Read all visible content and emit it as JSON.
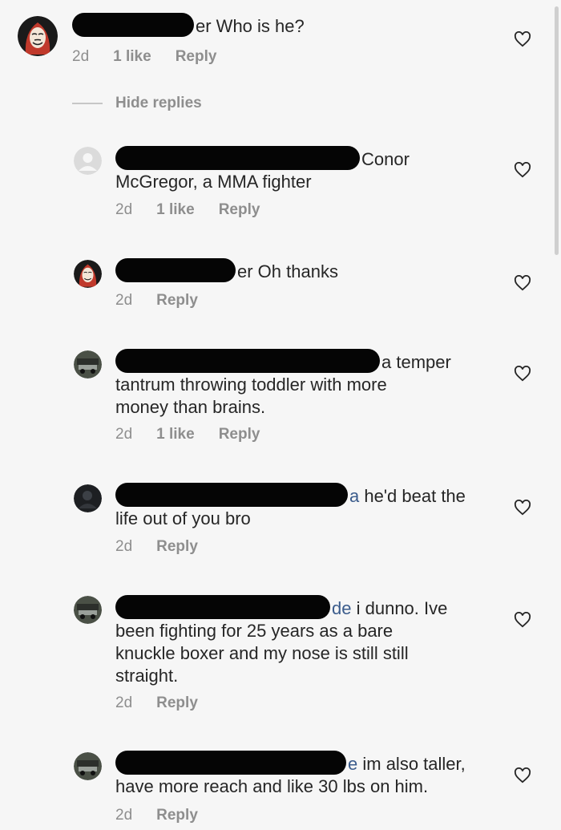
{
  "thread": {
    "hide_replies_label": "Hide replies"
  },
  "comments": [
    {
      "avatar": "mask-avatar",
      "text": "er Who is he?",
      "time": "2d",
      "likes": "1 like",
      "reply": "Reply"
    },
    {
      "avatar": "default-avatar",
      "line1": "Conor",
      "line2": "McGregor, a MMA fighter",
      "time": "2d",
      "likes": "1 like",
      "reply": "Reply"
    },
    {
      "avatar": "mask-avatar",
      "text": "er Oh thanks",
      "time": "2d",
      "reply": "Reply"
    },
    {
      "avatar": "car-avatar",
      "line1": "a temper",
      "line2": "tantrum throwing toddler with more",
      "line3": "money than brains.",
      "time": "2d",
      "likes": "1 like",
      "reply": "Reply"
    },
    {
      "avatar": "dark-avatar",
      "mention_tail": "a",
      "line1": "he'd beat the",
      "line2": "life out of you bro",
      "time": "2d",
      "reply": "Reply"
    },
    {
      "avatar": "car-avatar",
      "mention_tail": "de",
      "line1": "i dunno. Ive",
      "line2": "been fighting for 25 years as a bare",
      "line3": "knuckle boxer and my nose is still still",
      "line4": "straight.",
      "time": "2d",
      "reply": "Reply"
    },
    {
      "avatar": "car-avatar",
      "mention_tail": "e",
      "line1": "im also taller,",
      "line2": "have more reach and like 30 lbs on him.",
      "time": "2d",
      "reply": "Reply"
    }
  ],
  "colors": {
    "background": "#f6f6f6",
    "meta_text": "#8e8e8e",
    "redaction": "#050505"
  }
}
